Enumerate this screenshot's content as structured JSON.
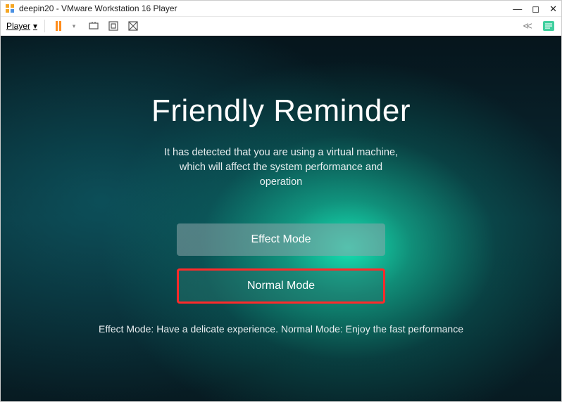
{
  "titlebar": {
    "title": "deepin20 - VMware Workstation 16 Player"
  },
  "toolbar": {
    "player_label": "Player"
  },
  "dialog": {
    "heading": "Friendly Reminder",
    "description": "It has detected that you are using a virtual machine, which will affect the system performance and operation",
    "effect_label": "Effect Mode",
    "normal_label": "Normal Mode",
    "hint": "Effect Mode: Have a delicate experience. Normal Mode: Enjoy the fast performance"
  }
}
